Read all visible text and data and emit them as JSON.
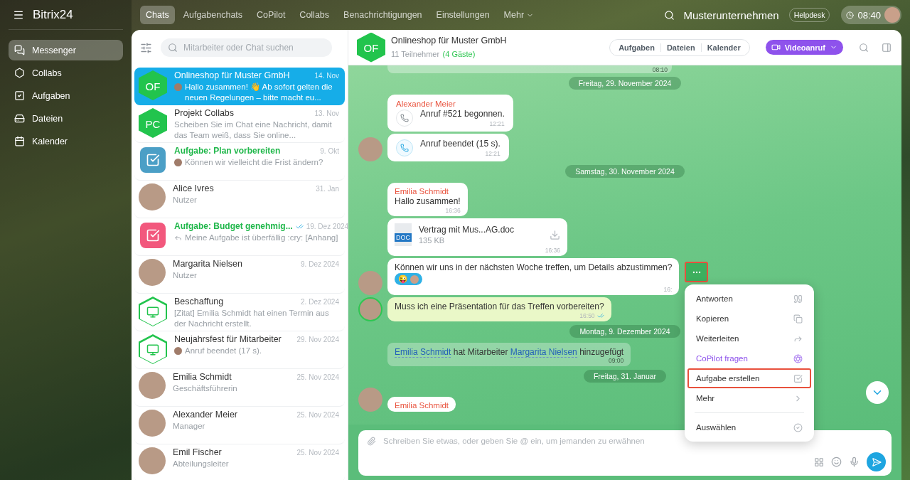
{
  "brand": {
    "name": "Bitrix24"
  },
  "nav": [
    {
      "label": "Messenger",
      "kind": "messenger",
      "selected": true
    },
    {
      "label": "Collabs",
      "kind": "collabs",
      "selected": false
    },
    {
      "label": "Aufgaben",
      "kind": "tasks",
      "selected": false
    },
    {
      "label": "Dateien",
      "kind": "files",
      "selected": false
    },
    {
      "label": "Kalender",
      "kind": "calendar",
      "selected": false
    }
  ],
  "tabs": [
    {
      "label": "Chats",
      "selected": true
    },
    {
      "label": "Aufgabenchats",
      "selected": false
    },
    {
      "label": "CoPilot",
      "selected": false
    },
    {
      "label": "Collabs",
      "selected": false
    },
    {
      "label": "Benachrichtigungen",
      "selected": false
    },
    {
      "label": "Einstellungen",
      "selected": false
    }
  ],
  "more_tab": "Mehr",
  "company": "Musterunternehmen",
  "helpdesk": "Helpdesk",
  "clock": "08:40",
  "search": {
    "placeholder": "Mitarbeiter oder Chat suchen"
  },
  "chats": [
    {
      "title": "Onlineshop für Muster GmbH",
      "date": "14. Nov",
      "preview": "Hallo zusammen! 👋 Ab sofort gelten die neuen Regelungen – bitte macht eu...",
      "kind": "initials",
      "initials": "OF",
      "preview_avatar": true,
      "selected": true
    },
    {
      "title": "Projekt Collabs",
      "date": "13. Nov",
      "preview": "Scheiben Sie im Chat eine Nachricht, damit das Team weiß, dass Sie online...",
      "kind": "initials",
      "initials": "PC",
      "selected": false
    },
    {
      "title": "Aufgabe: Plan vorbereiten",
      "date": "9. Okt",
      "preview": "Können wir vielleicht die Frist ändern?",
      "kind": "task",
      "color": "#4b9fc6",
      "preview_avatar": true,
      "selected": false
    },
    {
      "title": "Alice Ivres",
      "date": "31. Jan",
      "preview": "Nutzer",
      "kind": "photo",
      "selected": false
    },
    {
      "title": "Aufgabe: Budget genehmig...",
      "date": "19. Dez 2024",
      "preview": "Meine Aufgabe ist überfällig :cry: [Anhang]",
      "kind": "task",
      "color": "#f2587d",
      "reply": true,
      "read": true,
      "selected": false
    },
    {
      "title": "Margarita Nielsen",
      "date": "9. Dez 2024",
      "preview": "Nutzer",
      "kind": "photo",
      "selected": false
    },
    {
      "title": "Beschaffung",
      "date": "2. Dez 2024",
      "preview": "[Zitat] Emilia Schmidt hat einen Termin aus der Nachricht erstellt.",
      "kind": "group",
      "selected": false
    },
    {
      "title": "Neujahrsfest für Mitarbeiter",
      "date": "29. Nov 2024",
      "preview": "Anruf beendet (17 s).",
      "kind": "group",
      "preview_avatar": true,
      "selected": false
    },
    {
      "title": "Emilia Schmidt",
      "date": "25. Nov 2024",
      "preview": "Geschäftsführerin",
      "kind": "photo",
      "selected": false
    },
    {
      "title": "Alexander Meier",
      "date": "25. Nov 2024",
      "preview": "Manager",
      "kind": "photo",
      "selected": false
    },
    {
      "title": "Emil Fischer",
      "date": "25. Nov 2024",
      "preview": "Abteilungsleiter",
      "kind": "photo",
      "selected": false
    }
  ],
  "chat": {
    "title": "Onlineshop für Muster GmbH",
    "initials": "OF",
    "members": "11 Teilnehmer",
    "guests": "(4 Gäste)",
    "actions": [
      "Aufgaben",
      "Dateien",
      "Kalender"
    ],
    "video": "Videoanruf"
  },
  "messages": [
    {
      "kind": "stub",
      "time": "08:10"
    },
    {
      "kind": "date",
      "text": "Freitag, 29. November 2024"
    },
    {
      "kind": "call",
      "sender": "Alexander Meier",
      "text": "Anruf #521 begonnen.",
      "time": "12:21",
      "active": false,
      "avatar": false
    },
    {
      "kind": "call",
      "text": "Anruf beendet (15 s).",
      "time": "12:21",
      "active": true,
      "avatar": true
    },
    {
      "kind": "date",
      "text": "Samstag, 30. November 2024"
    },
    {
      "kind": "text",
      "sender": "Emilia Schmidt",
      "text": "Hallo zusammen!",
      "time": "16:36",
      "avatar": false,
      "own": false
    },
    {
      "kind": "file",
      "name": "Vertrag mit Mus...AG.doc",
      "size": "135 KB",
      "badge": "DOC",
      "time": "16:36",
      "avatar": false
    },
    {
      "kind": "text",
      "text": "Können wir uns in der nächsten Woche treffen, um Details abzustimmen?",
      "time": "16:",
      "reaction": "😜",
      "avatar": true,
      "own": false
    },
    {
      "kind": "text",
      "text": "Muss ich eine Präsentation für das Treffen vorbereiten?",
      "time": "16:50",
      "avatar": true,
      "own": true,
      "read": true
    },
    {
      "kind": "date",
      "text": "Montag, 9. Dezember 2024"
    },
    {
      "kind": "system",
      "user1": "Emilia Schmidt",
      "middle": "hat Mitarbeiter",
      "user2": "Margarita Nielsen",
      "end": "hinzugefügt",
      "time": "09:00"
    },
    {
      "kind": "date",
      "text": "Freitag, 31. Januar"
    },
    {
      "kind": "text",
      "sender": "Emilia Schmidt",
      "avatar": true,
      "own": false
    }
  ],
  "menu": [
    {
      "label": "Antworten",
      "kind": "reply",
      "selected": false
    },
    {
      "label": "Kopieren",
      "kind": "copy",
      "selected": false
    },
    {
      "label": "Weiterleiten",
      "kind": "forward",
      "selected": false
    },
    {
      "label": "CoPilot fragen",
      "kind": "ai",
      "selected": false
    },
    {
      "label": "Aufgabe erstellen",
      "kind": "task",
      "selected": true
    },
    {
      "label": "Mehr",
      "kind": "more",
      "selected": false
    },
    {
      "label": "Auswählen",
      "kind": "select",
      "selected": false
    }
  ],
  "composer": {
    "placeholder": "Schreiben Sie etwas, oder geben Sie @ ein, um jemanden zu erwähnen"
  }
}
